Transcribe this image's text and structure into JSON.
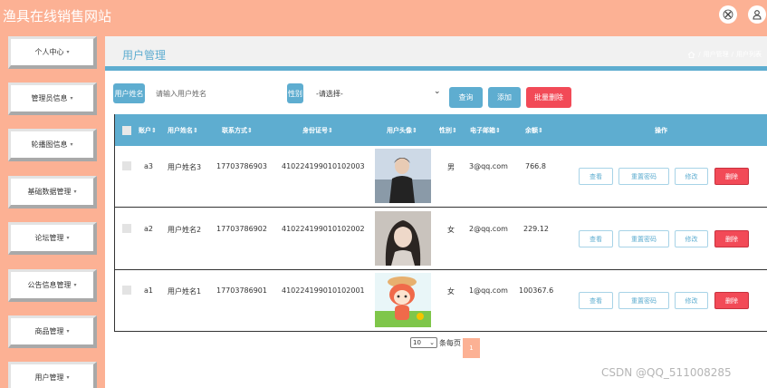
{
  "app": {
    "title": "渔具在线销售网站",
    "watermark": "CSDN @QQ_511008285"
  },
  "colors": {
    "accent": "#5eadd0",
    "brand": "#fcb194",
    "danger": "#f24a57",
    "add": "#5eadd0"
  },
  "topbar": {
    "icons": [
      "close-circle-icon",
      "user-icon"
    ]
  },
  "sidebar": {
    "items": [
      {
        "label": "个人中心",
        "caret": "▾"
      },
      {
        "label": "管理员信息",
        "caret": "▾"
      },
      {
        "label": "轮播图信息",
        "caret": "▾"
      },
      {
        "label": "基础数据管理",
        "caret": "▾"
      },
      {
        "label": "论坛管理",
        "caret": "▾"
      },
      {
        "label": "公告信息管理",
        "caret": "▾"
      },
      {
        "label": "商品管理",
        "caret": "▾"
      },
      {
        "label": "用户管理",
        "caret": "▾"
      }
    ]
  },
  "header": {
    "title": "用户管理",
    "breadcrumb": [
      "/",
      "用户管理",
      "/",
      "用户列表"
    ]
  },
  "search": {
    "name_label": "用户姓名",
    "name_placeholder": "请输入用户姓名",
    "gender_label": "性别",
    "gender_value": "-请选择-",
    "gender_caret": "⌄",
    "query_button": "查询",
    "add_button": "添加",
    "batch_delete_button": "批量删除"
  },
  "table": {
    "headers": [
      "账户",
      "用户姓名",
      "联系方式",
      "身份证号",
      "用户头像",
      "性别",
      "电子邮箱",
      "余额",
      "操作"
    ],
    "rows": [
      {
        "account": "a3",
        "name": "用户姓名3",
        "phone": "17703786903",
        "id_card": "410224199010102003",
        "gender": "男",
        "email": "3@qq.com",
        "balance": "766.8",
        "avatar": "photo-boy-icon"
      },
      {
        "account": "a2",
        "name": "用户姓名2",
        "phone": "17703786902",
        "id_card": "410224199010102002",
        "gender": "女",
        "email": "2@qq.com",
        "balance": "229.12",
        "avatar": "photo-girl-icon"
      },
      {
        "account": "a1",
        "name": "用户姓名1",
        "phone": "17703786901",
        "id_card": "410224199010102001",
        "gender": "女",
        "email": "1@qq.com",
        "balance": "100367.6",
        "avatar": "cartoon-icon"
      }
    ],
    "actions": {
      "view": "查看",
      "reset": "重置密码",
      "edit": "修改",
      "delete": "删除"
    }
  },
  "pagination": {
    "page_size": "10",
    "page_size_caret": "⌄",
    "per_page_label": "条每页",
    "current_page": "1"
  }
}
